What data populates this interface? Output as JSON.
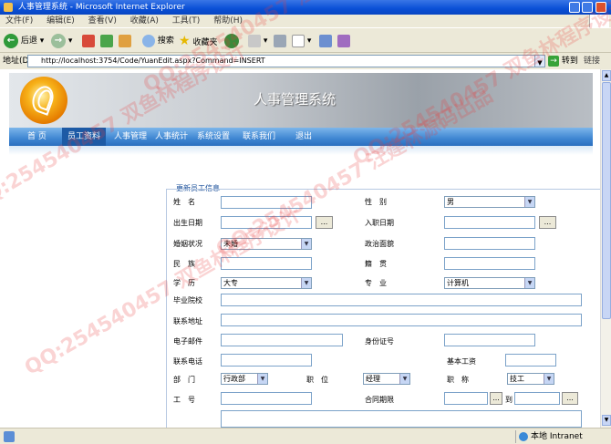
{
  "window": {
    "title": "人事管理系统 - Microsoft Internet Explorer"
  },
  "menu": [
    "文件(F)",
    "编辑(E)",
    "查看(V)",
    "收藏(A)",
    "工具(T)",
    "帮助(H)"
  ],
  "toolbar": {
    "back": "后退",
    "search": "搜索",
    "favorites": "收藏夹"
  },
  "address": {
    "label": "地址(D)",
    "url": "http://localhost:3754/Code/YuanEdit.aspx?Command=INSERT",
    "go": "转到",
    "links": "链接"
  },
  "banner": {
    "title": "人事管理系统"
  },
  "nav": [
    "首 页",
    "员工资料",
    "人事管理",
    "人事统计",
    "系统设置",
    "联系我们",
    "退出"
  ],
  "form": {
    "section_title": "更新员工信息",
    "labels": {
      "name": "姓　名",
      "gender": "性　别",
      "birth": "出生日期",
      "join": "入职日期",
      "marriage": "婚姻状况",
      "politics": "政治面貌",
      "nation": "民　族",
      "native": "籍　贯",
      "education": "学　历",
      "major": "专　业",
      "school": "毕业院校",
      "address": "联系地址",
      "email": "电子邮件",
      "idcard": "身份证号",
      "phone": "联系电话",
      "salary": "基本工资",
      "dept": "部　门",
      "position": "职　位",
      "title": "职　称",
      "workno": "工　号",
      "contract": "合同期限",
      "to": "到"
    },
    "values": {
      "gender": "男",
      "marriage": "未婚",
      "education": "大专",
      "major": "计算机",
      "dept": "行政部",
      "position": "经理",
      "title": "技工"
    },
    "dots": "..."
  },
  "status": {
    "zone": "本地 Intranet"
  },
  "watermark": {
    "line1": "QQ:254540457 汪建林源码出品",
    "line2": "QQ:254540457 双鱼林程序设计"
  }
}
